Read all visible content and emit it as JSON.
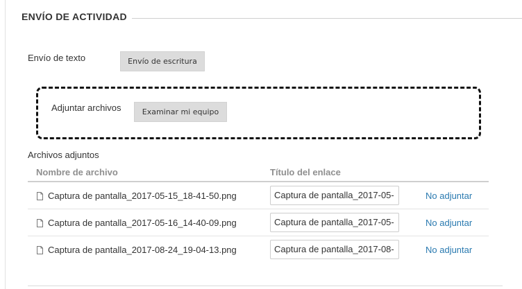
{
  "section": {
    "title": "ENVÍO DE ACTIVIDAD"
  },
  "text_submission": {
    "label": "Envío de texto",
    "button_label": "Envío de escritura"
  },
  "attach_files": {
    "label": "Adjuntar archivos",
    "button_label": "Examinar mi equipo"
  },
  "attachments": {
    "heading": "Archivos adjuntos",
    "columns": {
      "file_name": "Nombre de archivo",
      "link_title": "Título del enlace"
    },
    "rows": [
      {
        "file_name": "Captura de pantalla_2017-05-15_18-41-50.png",
        "link_title": "Captura de pantalla_2017-05-",
        "action": "No adjuntar",
        "icon": "file-icon"
      },
      {
        "file_name": "Captura de pantalla_2017-05-16_14-40-09.png",
        "link_title": "Captura de pantalla_2017-05-",
        "action": "No adjuntar",
        "icon": "file-icon"
      },
      {
        "file_name": "Captura de pantalla_2017-08-24_19-04-13.png",
        "link_title": "Captura de pantalla_2017-08-",
        "action": "No adjuntar",
        "icon": "file-icon"
      }
    ]
  },
  "colors": {
    "link": "#2a7ab0",
    "button_bg": "#dcdcdc",
    "highlight_border": "#111111",
    "column_header": "#8f8f8f"
  }
}
